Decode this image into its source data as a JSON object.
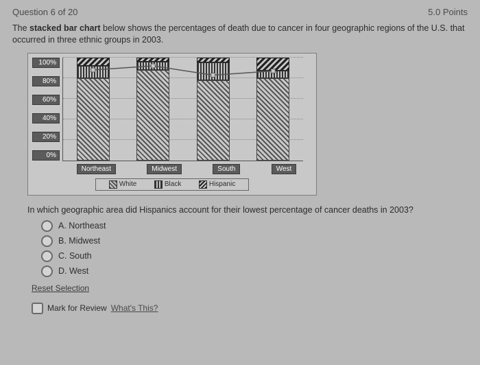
{
  "header": {
    "progress": "Question 6 of 20",
    "points": "5.0 Points"
  },
  "stem_prefix": "The ",
  "stem_bold": "stacked bar chart",
  "stem_rest": " below shows the percentages of death due to cancer in four geographic regions of the U.S. that occurred in three ethnic groups in 2003.",
  "chart_data": {
    "type": "bar",
    "stacked": true,
    "categories": [
      "Northeast",
      "Midwest",
      "South",
      "West"
    ],
    "series": [
      {
        "name": "White",
        "values": [
          80,
          88,
          78,
          80
        ]
      },
      {
        "name": "Black",
        "values": [
          12,
          8,
          17,
          7
        ]
      },
      {
        "name": "Hispanic",
        "values": [
          8,
          4,
          5,
          13
        ]
      }
    ],
    "ylabel": "",
    "xlabel": "",
    "ylim": [
      0,
      100
    ],
    "yticks": [
      "100%",
      "80%",
      "60%",
      "40%",
      "20%",
      "0%"
    ],
    "legend": [
      "White",
      "Black",
      "Hispanic"
    ],
    "overlay_line_y": [
      88,
      92,
      83,
      87
    ]
  },
  "question": "In which geographic area did Hispanics account for their lowest percentage of cancer deaths in 2003?",
  "choices": [
    {
      "key": "A",
      "label": "A. Northeast"
    },
    {
      "key": "B",
      "label": "B. Midwest"
    },
    {
      "key": "C",
      "label": "C. South"
    },
    {
      "key": "D",
      "label": "D. West"
    }
  ],
  "reset_label": "Reset Selection",
  "review_label": "Mark for Review",
  "whats_this": "What's This?"
}
